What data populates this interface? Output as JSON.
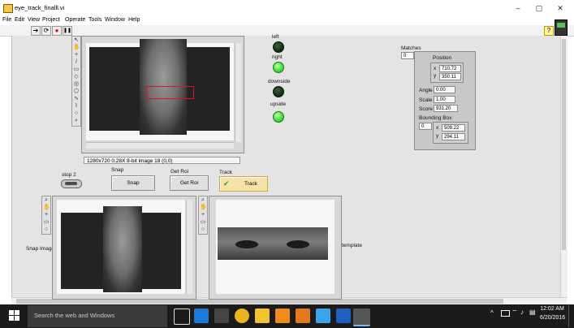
{
  "window": {
    "title": "eye_track_finalll.vi",
    "min": "–",
    "max": "▢",
    "close": "✕"
  },
  "menu": [
    "File",
    "Edit",
    "View",
    "Project",
    "Operate",
    "Tools",
    "Window",
    "Help"
  ],
  "toolbar": {
    "run": "➔",
    "run_continuous": "⟳",
    "abort": "●",
    "pause": "❚❚",
    "help": "?"
  },
  "leds": {
    "left": "left",
    "right": "right",
    "downside": "downside",
    "upside": "upside"
  },
  "image_status": "1280x720 0.28X 8-bit image 18   (0,0)",
  "stop": "stop 2",
  "buttons": {
    "snap_caption": "Snap",
    "snap_label": "Snap",
    "getroi_caption": "Get Roi",
    "getroi_label": "Get Roi",
    "track_caption": "Track",
    "track_label": "Track"
  },
  "labels": {
    "snap_image": "Snap Image",
    "template": "template"
  },
  "matches": {
    "caption": "Matches",
    "index": "0",
    "position_label": "Position",
    "x_label": "x",
    "x_value": "710.72",
    "y_label": "y",
    "y_value": "350.11",
    "angle_label": "Angle",
    "angle_value": "0.00",
    "scale_label": "Scale",
    "scale_value": "1.00",
    "score_label": "Score",
    "score_value": "931.20",
    "bbox_label": "Bounding Box",
    "bbox_index": "0",
    "bbox_x_label": "x",
    "bbox_x_value": "509.22",
    "bbox_y_label": "y",
    "bbox_y_value": "294.11"
  },
  "taskbar": {
    "search_placeholder": "Search the web and Windows",
    "time": "12:02 AM",
    "date": "6/20/2016"
  },
  "colors": {
    "led_on": "#4ee84e",
    "led_off": "#173018",
    "roi_rect": "#e0102a",
    "taskbar": "#1b1b1b"
  }
}
